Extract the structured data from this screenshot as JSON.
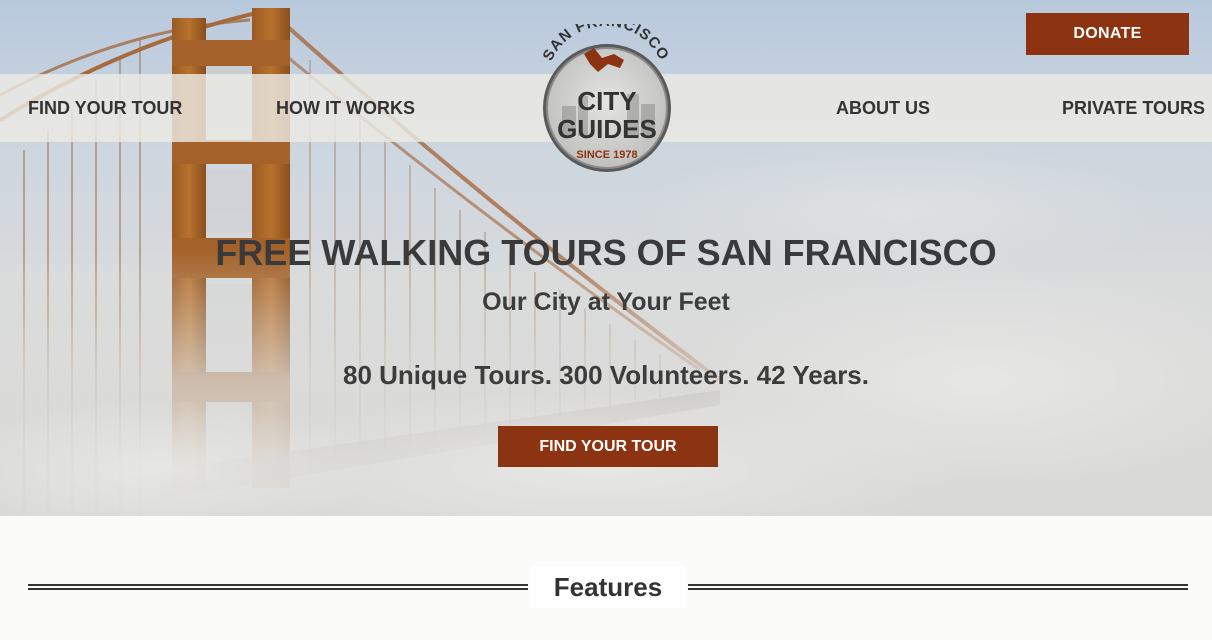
{
  "header": {
    "donate_label": "DONATE",
    "nav_left": [
      "FIND YOUR TOUR",
      "HOW IT WORKS"
    ],
    "nav_right": [
      "ABOUT US",
      "PRIVATE TOURS"
    ]
  },
  "logo": {
    "top_text": "SAN FRANCISCO",
    "line1": "CITY",
    "line2": "GUIDES",
    "since": "SINCE 1978"
  },
  "hero": {
    "title": "FREE WALKING TOURS OF SAN FRANCISCO",
    "subtitle": "Our City at Your Feet",
    "stats": "80 Unique Tours. 300 Volunteers. 42 Years.",
    "cta_label": "FIND YOUR TOUR"
  },
  "section": {
    "heading": "Features"
  },
  "colors": {
    "accent": "#8c3312",
    "text": "#333333",
    "background": "#fbfbf9"
  }
}
